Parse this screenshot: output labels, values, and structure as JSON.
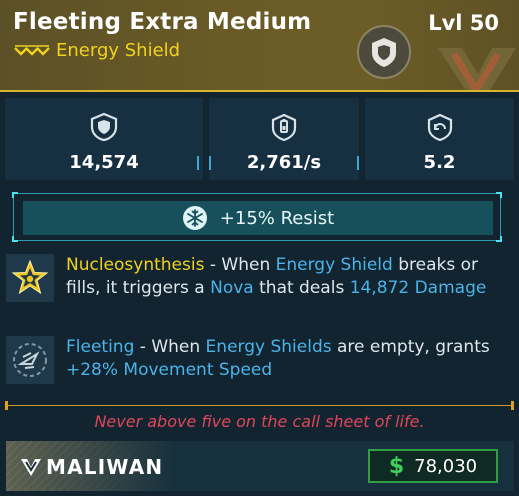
{
  "item": {
    "name": "Fleeting Extra Medium",
    "level": "Lvl 50",
    "type": "Energy Shield",
    "rarity_color": "#f2d21e"
  },
  "stats": [
    {
      "icon": "shield-capacity-icon",
      "value": "14,574"
    },
    {
      "icon": "recharge-rate-icon",
      "value": "2,761/s"
    },
    {
      "icon": "recharge-delay-icon",
      "value": "5.2"
    }
  ],
  "resist": {
    "icon": "cryo-snowflake-icon",
    "text": "+15% Resist"
  },
  "perks": [
    {
      "icon": "star-badge-icon",
      "parts": [
        {
          "t": "Nucleosynthesis",
          "c": "gold"
        },
        {
          "t": " - When ",
          "c": "plain"
        },
        {
          "t": "Energy Shield",
          "c": "blue"
        },
        {
          "t": " breaks or fills, it triggers a ",
          "c": "plain"
        },
        {
          "t": "Nova",
          "c": "blue"
        },
        {
          "t": " that deals ",
          "c": "plain"
        },
        {
          "t": "14,872 Damage",
          "c": "blue"
        }
      ]
    },
    {
      "icon": "speed-wing-icon",
      "parts": [
        {
          "t": "Fleeting",
          "c": "blue"
        },
        {
          "t": " - When ",
          "c": "plain"
        },
        {
          "t": "Energy Shields",
          "c": "blue"
        },
        {
          "t": " are empty, grants ",
          "c": "plain"
        },
        {
          "t": "+28% Movement Speed",
          "c": "blue"
        }
      ]
    }
  ],
  "flavor_text": "Never above five on the call sheet of life.",
  "manufacturer": "MALIWAN",
  "price": {
    "symbol": "$",
    "value": "78,030"
  },
  "colors": {
    "header": "#6a5b26",
    "accent_gold": "#f2d21e",
    "keyword_blue": "#4bb3ea",
    "flavor_red": "#e0465a",
    "price_green": "#3fcf5a"
  }
}
